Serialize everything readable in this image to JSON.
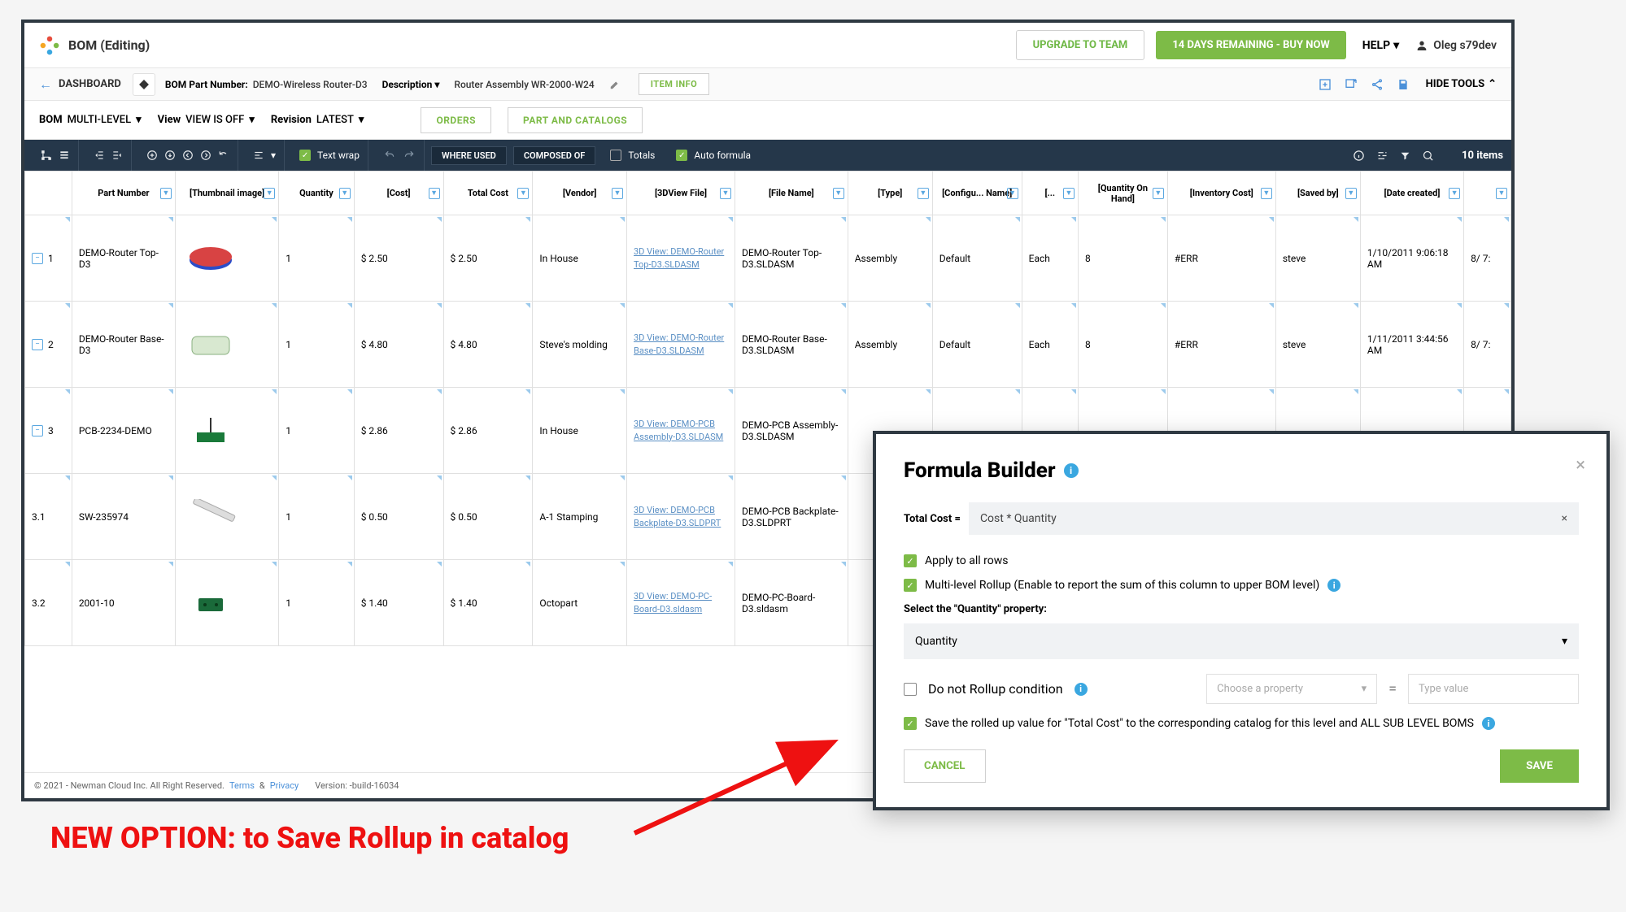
{
  "topbar": {
    "title": "BOM (Editing)",
    "upgrade_btn": "UPGRADE TO TEAM",
    "trial_btn": "14 DAYS REMAINING - BUY NOW",
    "help_label": "HELP",
    "user_name": "Oleg s79dev"
  },
  "crumb": {
    "dashboard": "DASHBOARD",
    "pn_label": "BOM Part Number:",
    "pn_value": "DEMO-Wireless Router-D3",
    "desc_label": "Description",
    "desc_value": "Router Assembly WR-2000-W24",
    "item_info": "ITEM INFO",
    "hide_tools": "HIDE TOOLS"
  },
  "viewbar": {
    "bom_label": "BOM",
    "bom_value": "MULTI-LEVEL",
    "view_label": "View",
    "view_value": "VIEW IS OFF",
    "rev_label": "Revision",
    "rev_value": "LATEST",
    "orders_btn": "ORDERS",
    "catalogs_btn": "PART AND CATALOGS"
  },
  "darktb": {
    "text_wrap": "Text wrap",
    "where_used": "WHERE USED",
    "composed_of": "COMPOSED OF",
    "totals": "Totals",
    "auto_formula": "Auto formula",
    "items": "10 items"
  },
  "columns": [
    "",
    "Part Number",
    "[Thumbnail image]",
    "Quantity",
    "[Cost]",
    "Total Cost",
    "[Vendor]",
    "[3DView File]",
    "[File Name]",
    "[Type]",
    "[Configu... Name]",
    "[...",
    "[Quantity On Hand]",
    "[Inventory Cost]",
    "[Saved by]",
    "[Date created]",
    ""
  ],
  "rows": [
    {
      "idx": "1",
      "toggle": true,
      "pn": "DEMO-Router Top-D3",
      "qty": "1",
      "cost": "$ 2.50",
      "total": "$ 2.50",
      "vendor": "In House",
      "view": "3D View: DEMO-Router Top-D3.SLDASM",
      "fname": "DEMO-Router Top-D3.SLDASM",
      "type": "Assembly",
      "config": "Default",
      "uom": "Each",
      "qoh": "8",
      "invcost": "#ERR",
      "savedby": "steve",
      "created": "1/10/2011 9:06:18 AM",
      "extra": "8/\n7:"
    },
    {
      "idx": "2",
      "toggle": true,
      "pn": "DEMO-Router Base-D3",
      "qty": "1",
      "cost": "$ 4.80",
      "total": "$ 4.80",
      "vendor": "Steve's molding",
      "view": "3D View: DEMO-Router Base-D3.SLDASM",
      "fname": "DEMO-Router Base-D3.SLDASM",
      "type": "Assembly",
      "config": "Default",
      "uom": "Each",
      "qoh": "8",
      "invcost": "#ERR",
      "savedby": "steve",
      "created": "1/11/2011 3:44:56 AM",
      "extra": "8/\n7:"
    },
    {
      "idx": "3",
      "toggle": true,
      "pn": "PCB-2234-DEMO",
      "qty": "1",
      "cost": "$ 2.86",
      "total": "$ 2.86",
      "vendor": "In House",
      "view": "3D View: DEMO-PCB Assembly-D3.SLDASM",
      "fname": "DEMO-PCB Assembly-D3.SLDASM",
      "type": "",
      "config": "",
      "uom": "",
      "qoh": "",
      "invcost": "",
      "savedby": "",
      "created": "",
      "extra": ""
    },
    {
      "idx": "3.1",
      "toggle": false,
      "pn": "SW-235974",
      "qty": "1",
      "cost": "$ 0.50",
      "total": "$ 0.50",
      "vendor": "A-1 Stamping",
      "view": "3D View: DEMO-PCB Backplate-D3.SLDPRT",
      "fname": "DEMO-PCB Backplate-D3.SLDPRT",
      "type": "",
      "config": "",
      "uom": "",
      "qoh": "",
      "invcost": "",
      "savedby": "",
      "created": "",
      "extra": ""
    },
    {
      "idx": "3.2",
      "toggle": false,
      "pn": "2001-10",
      "qty": "1",
      "cost": "$ 1.40",
      "total": "$ 1.40",
      "vendor": "Octopart",
      "view": "3D View: DEMO-PC-Board-D3.sldasm",
      "fname": "DEMO-PC-Board-D3.sldasm",
      "type": "",
      "config": "",
      "uom": "",
      "qoh": "",
      "invcost": "",
      "savedby": "",
      "created": "",
      "extra": ""
    }
  ],
  "footer": {
    "copyright": "© 2021 - Newman Cloud Inc. All Right Reserved.",
    "terms": "Terms",
    "amp": "&",
    "privacy": "Privacy",
    "version": "Version: -build-16034"
  },
  "modal": {
    "title": "Formula Builder",
    "lhs": "Total Cost =",
    "formula": "Cost  *  Quantity",
    "apply_all": "Apply to all rows",
    "rollup": "Multi-level Rollup (Enable to report the sum of this column to upper BOM level)",
    "select_qty_label": "Select the \"Quantity\" property:",
    "qty_value": "Quantity",
    "no_rollup": "Do not Rollup condition",
    "choose_prop": "Choose a property",
    "type_value": "Type value",
    "save_rolled": "Save the rolled up value for \"Total Cost\" to the corresponding catalog for this level and ALL SUB LEVEL BOMS",
    "cancel": "CANCEL",
    "save": "SAVE"
  },
  "annotation": "NEW OPTION: to Save Rollup in catalog"
}
